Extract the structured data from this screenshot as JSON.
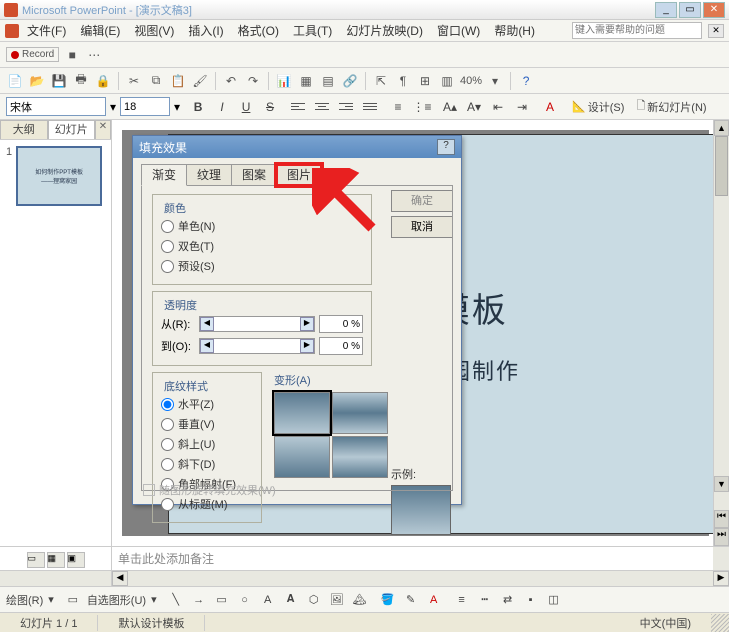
{
  "titlebar": {
    "title": "Microsoft PowerPoint - [演示文稿3]"
  },
  "menu": {
    "file": "文件(F)",
    "edit": "编辑(E)",
    "view": "视图(V)",
    "insert": "插入(I)",
    "format": "格式(O)",
    "tools": "工具(T)",
    "slideshow": "幻灯片放映(D)",
    "window": "窗口(W)",
    "help": "帮助(H)",
    "help_placeholder": "键入需要帮助的问题"
  },
  "toolbar": {
    "record": "Record",
    "zoom": "40%"
  },
  "fontbar": {
    "font": "宋体",
    "size": "18",
    "design": "设计(S)",
    "newslide": "新幻灯片(N)"
  },
  "tabs": {
    "outline": "大纲",
    "slides": "幻灯片"
  },
  "thumb": {
    "num": "1",
    "t1": "如何制作PPT模板",
    "t2": "——狸窝家园"
  },
  "slide": {
    "line1": "PT模板",
    "line2": "狸窝家园制作"
  },
  "notes": {
    "placeholder": "单击此处添加备注"
  },
  "dialog": {
    "title": "填充效果",
    "tabs": {
      "gradient": "渐变",
      "texture": "纹理",
      "pattern": "图案",
      "picture": "图片"
    },
    "ok": "确定",
    "cancel": "取消",
    "colors": {
      "legend": "颜色",
      "one": "单色(N)",
      "two": "双色(T)",
      "preset": "预设(S)"
    },
    "transparency": {
      "legend": "透明度",
      "from": "从(R):",
      "to": "到(O):",
      "pct": "0 %"
    },
    "shading": {
      "legend": "底纹样式",
      "h": "水平(Z)",
      "v": "垂直(V)",
      "du": "斜上(U)",
      "dd": "斜下(D)",
      "corner": "角部幅射(F)",
      "title": "从标题(M)"
    },
    "variants": "变形(A)",
    "sample": "示例:",
    "rotate_lock": "随图形旋转填充效果(W)"
  },
  "drawbar": {
    "draw": "绘图(R)",
    "autoshape": "自选图形(U)"
  },
  "status": {
    "slide": "幻灯片 1 / 1",
    "template": "默认设计模板",
    "lang": "中文(中国)"
  }
}
